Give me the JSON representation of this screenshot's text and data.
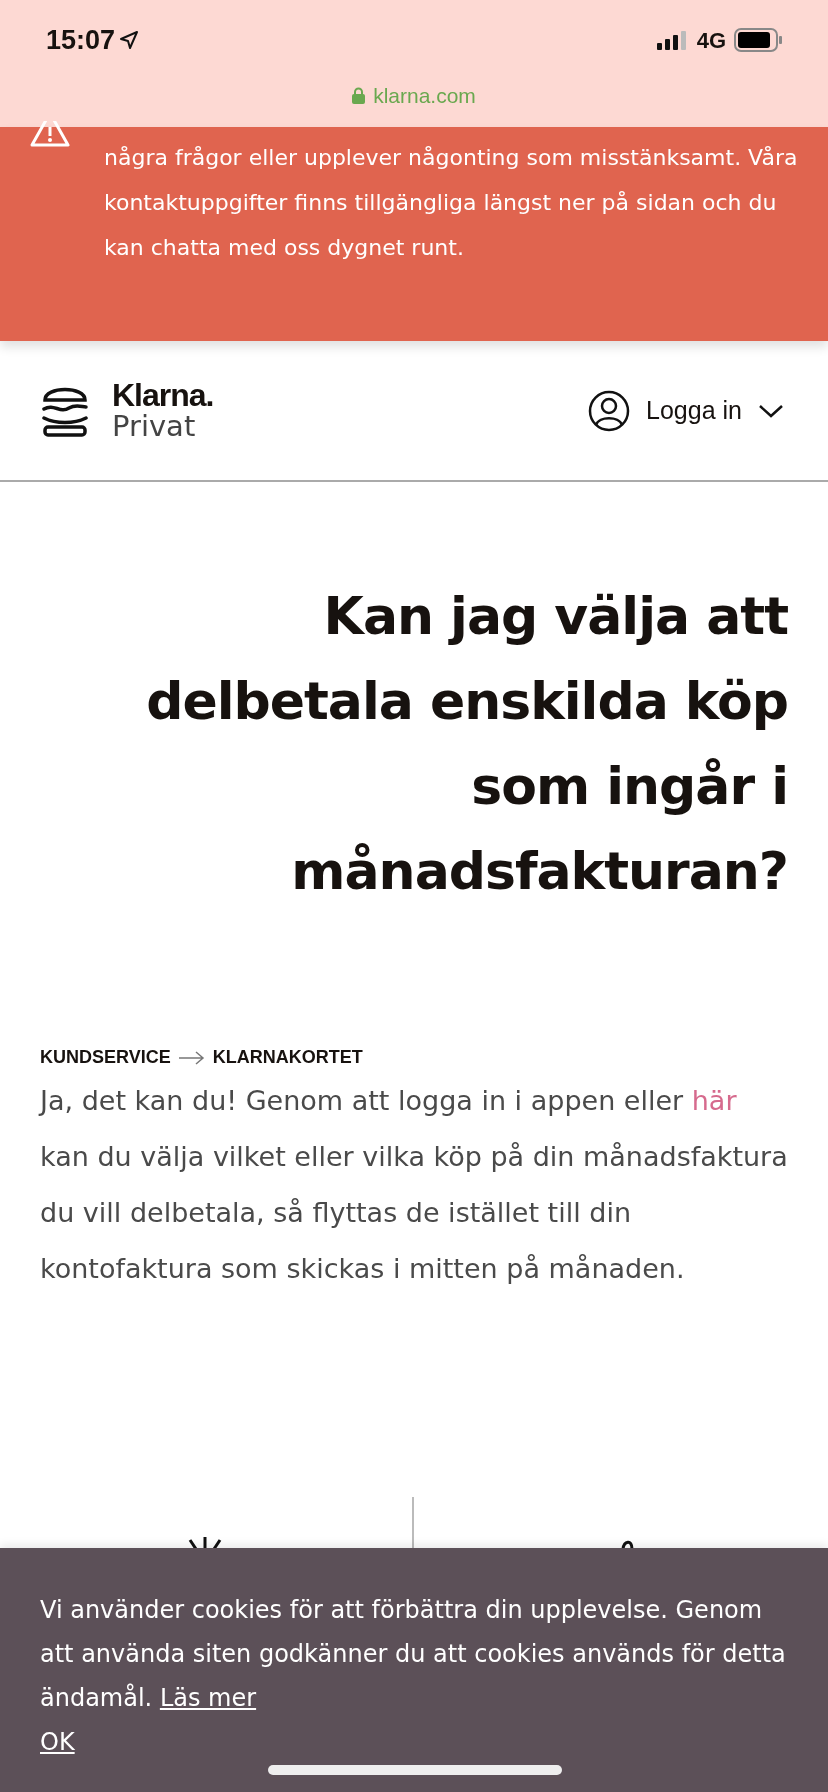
{
  "status_bar": {
    "time": "15:07",
    "network": "4G"
  },
  "url_bar": {
    "domain": "klarna.com"
  },
  "alert": {
    "text": "några frågor eller upplever någonting som misstänksamt. Våra kontaktuppgifter finns tillgängliga längst ner på sidan och du kan chatta med oss dygnet runt."
  },
  "header": {
    "brand": "Klarna.",
    "section": "Privat",
    "login": "Logga in"
  },
  "article": {
    "title": "Kan jag välja att delbetala enskilda köp som ingår i månadsfakturan?",
    "breadcrumb": [
      "KUNDSERVICE",
      "KLARNAKORTET"
    ],
    "body_before": "Ja, det kan du! Genom att logga in i appen eller ",
    "body_link": "här",
    "body_after": " kan du välja vilket eller vilka köp på din månadsfaktura du vill delbetala, så flyttas de istället till din kontofaktura som skickas i mitten på månaden."
  },
  "cookie_banner": {
    "text": "Vi använder cookies för att förbättra din upplevelse. Genom att använda siten godkänner du att cookies används för detta ändamål. ",
    "link": "Läs mer",
    "button": "OK"
  }
}
